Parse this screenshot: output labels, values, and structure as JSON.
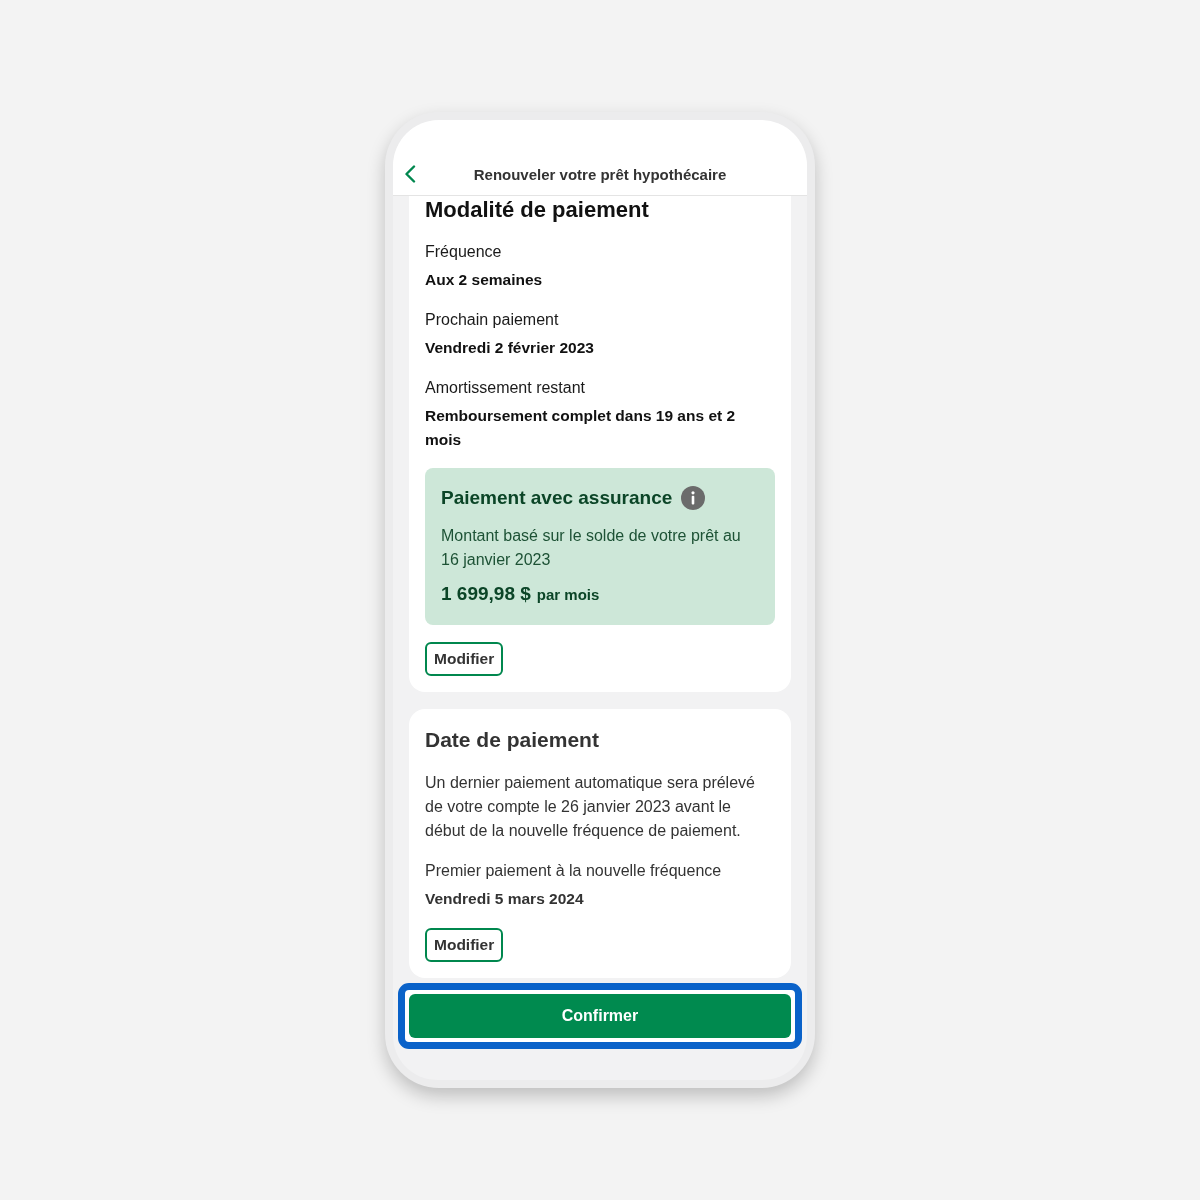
{
  "header": {
    "title": "Renouveler votre prêt hypothécaire"
  },
  "payment_terms": {
    "title": "Modalité de paiement",
    "fields": [
      {
        "label": "Fréquence",
        "value": "Aux 2 semaines"
      },
      {
        "label": "Prochain paiement",
        "value": "Vendredi 2 février 2023"
      },
      {
        "label": "Amortissement restant",
        "value": "Remboursement complet dans 19 ans et 2 mois"
      }
    ],
    "insurance_panel": {
      "title": "Paiement avec assurance",
      "text": "Montant basé sur le solde de votre prêt au 16 janvier 2023",
      "amount": "1 699,98 $",
      "period": "par mois"
    },
    "button": "Modifier"
  },
  "payment_date": {
    "title": "Date de paiement",
    "text": "Un dernier paiement automatique sera prélevé de votre compte le 26 janvier 2023 avant le début de la nouvelle fréquence de paiement.",
    "fields": [
      {
        "label": "Premier paiement à la nouvelle fréquence",
        "value": "Vendredi 5 mars 2024"
      }
    ],
    "button": "Modifier"
  },
  "confirm_button": {
    "label": "Confirmer",
    "focused": true
  }
}
